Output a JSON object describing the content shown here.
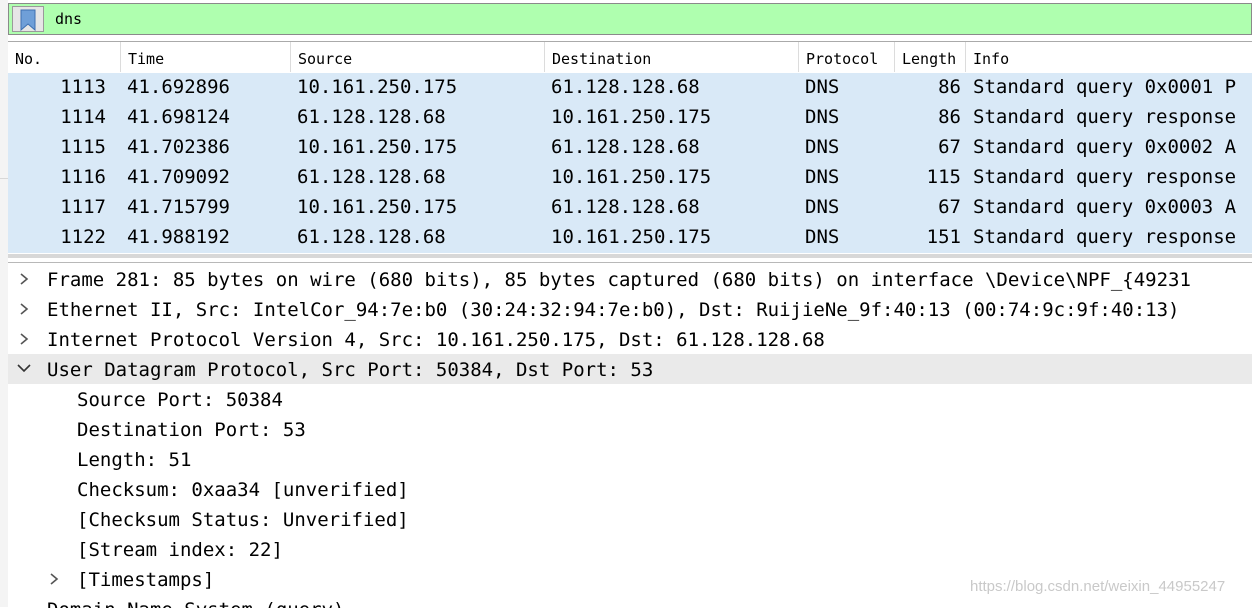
{
  "filter": {
    "value": "dns",
    "bookmark_icon": "bookmark-icon"
  },
  "packet_list": {
    "columns": [
      "No.",
      "Time",
      "Source",
      "Destination",
      "Protocol",
      "Length",
      "Info"
    ],
    "rows": [
      [
        "1113",
        "41.692896",
        "10.161.250.175",
        "61.128.128.68",
        "DNS",
        "86",
        "Standard query 0x0001 P"
      ],
      [
        "1114",
        "41.698124",
        "61.128.128.68",
        "10.161.250.175",
        "DNS",
        "86",
        "Standard query response"
      ],
      [
        "1115",
        "41.702386",
        "10.161.250.175",
        "61.128.128.68",
        "DNS",
        "67",
        "Standard query 0x0002 A"
      ],
      [
        "1116",
        "41.709092",
        "61.128.128.68",
        "10.161.250.175",
        "DNS",
        "115",
        "Standard query response"
      ],
      [
        "1117",
        "41.715799",
        "10.161.250.175",
        "61.128.128.68",
        "DNS",
        "67",
        "Standard query 0x0003 A"
      ],
      [
        "1122",
        "41.988192",
        "61.128.128.68",
        "10.161.250.175",
        "DNS",
        "151",
        "Standard query response"
      ]
    ],
    "row_color": "#d9e9f7"
  },
  "details": {
    "frame": "Frame 281: 85 bytes on wire (680 bits), 85 bytes captured (680 bits) on interface \\Device\\NPF_{49231",
    "ethernet": "Ethernet II, Src: IntelCor_94:7e:b0 (30:24:32:94:7e:b0), Dst: RuijieNe_9f:40:13 (00:74:9c:9f:40:13)",
    "ip": "Internet Protocol Version 4, Src: 10.161.250.175, Dst: 61.128.128.68",
    "udp": "User Datagram Protocol, Src Port: 50384, Dst Port: 53",
    "udp_fields": {
      "src_port": "Source Port: 50384",
      "dst_port": "Destination Port: 53",
      "length": "Length: 51",
      "checksum": "Checksum: 0xaa34 [unverified]",
      "checksum_status": "[Checksum Status: Unverified]",
      "stream_index": "[Stream index: 22]",
      "timestamps": "[Timestamps]"
    },
    "dns": "Domain Name System (query)"
  },
  "watermark": "https://blog.csdn.net/weixin_44955247"
}
